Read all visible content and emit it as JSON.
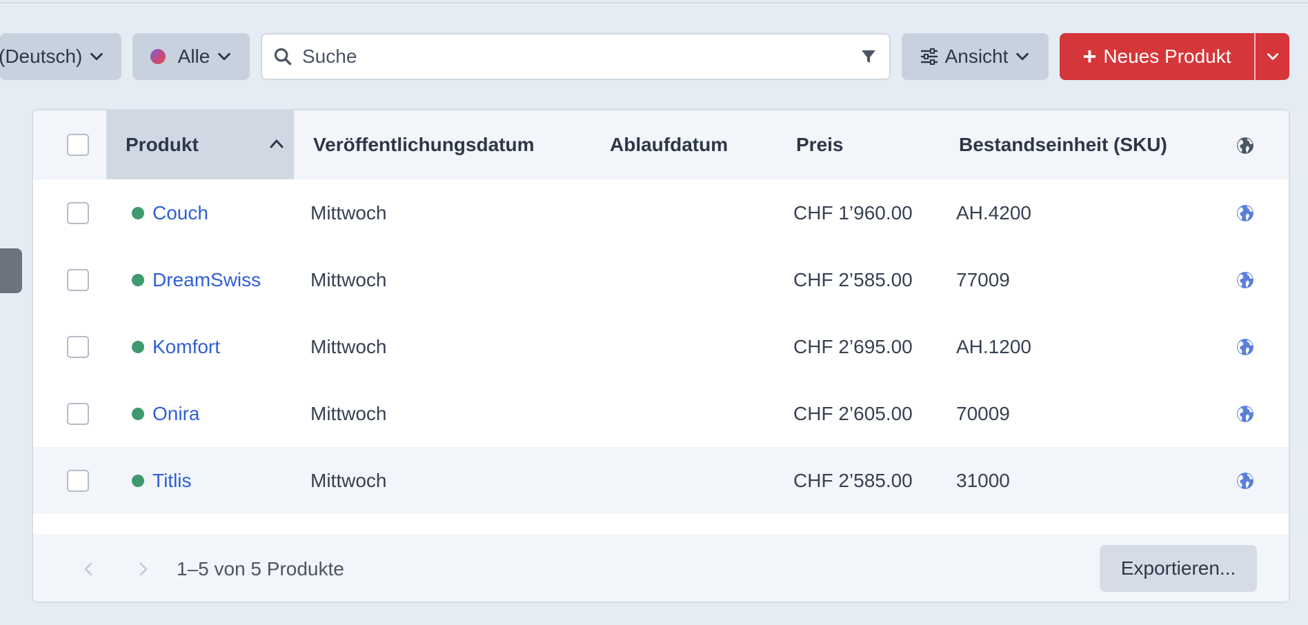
{
  "toolbar": {
    "language_label": "(Deutsch)",
    "filter_label": "Alle",
    "search_placeholder": "Suche",
    "view_label": "Ansicht",
    "new_product_label": "Neues Produkt",
    "accent_color": "#d5363a"
  },
  "table": {
    "columns": {
      "product": "Produkt",
      "publish_date": "Veröffentlichungsdatum",
      "expiry_date": "Ablaufdatum",
      "price": "Preis",
      "sku": "Bestandseinheit (SKU)",
      "visibility_icon": "globe-icon"
    },
    "sort": {
      "column": "product",
      "direction": "ascending"
    },
    "rows": [
      {
        "name": "Couch",
        "publish": "Mittwoch",
        "expiry": "",
        "price": "CHF 1’960.00",
        "sku": "AH.4200",
        "status": "active"
      },
      {
        "name": "DreamSwiss",
        "publish": "Mittwoch",
        "expiry": "",
        "price": "CHF 2’585.00",
        "sku": "77009",
        "status": "active"
      },
      {
        "name": "Komfort",
        "publish": "Mittwoch",
        "expiry": "",
        "price": "CHF 2’695.00",
        "sku": "AH.1200",
        "status": "active"
      },
      {
        "name": "Onira",
        "publish": "Mittwoch",
        "expiry": "",
        "price": "CHF 2’605.00",
        "sku": "70009",
        "status": "active"
      },
      {
        "name": "Titlis",
        "publish": "Mittwoch",
        "expiry": "",
        "price": "CHF 2’585.00",
        "sku": "31000",
        "status": "active"
      }
    ],
    "status_color": "#3d9a6e",
    "link_color": "#2f5fd6"
  },
  "footer": {
    "pagination_text": "1–5 von 5 Produkte",
    "export_label": "Exportieren..."
  }
}
